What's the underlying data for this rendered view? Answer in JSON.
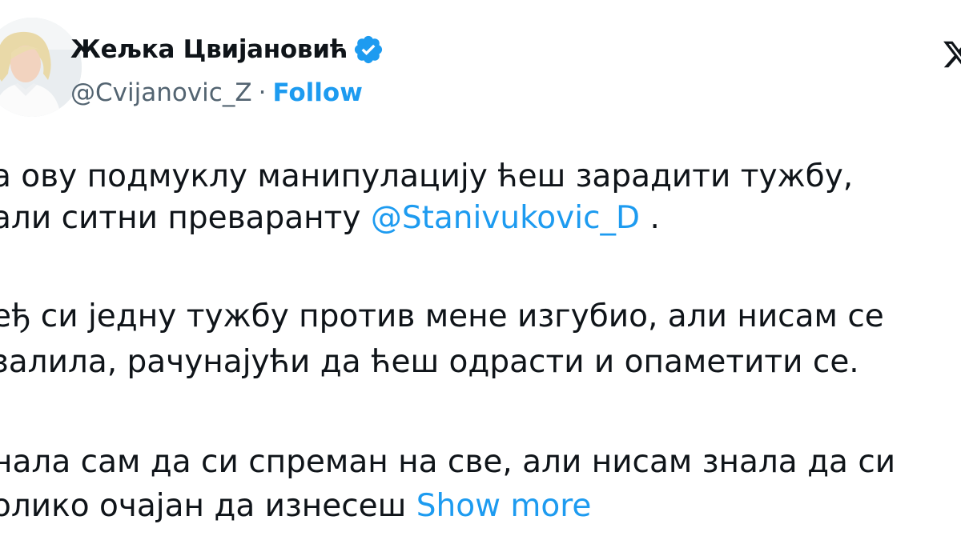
{
  "author": {
    "display_name": "Жељка Цвијановић",
    "handle": "@Cvijanovic_Z",
    "separator": "·",
    "follow_label": "Follow",
    "verified_icon": "verified-badge-icon",
    "avatar": "profile-photo"
  },
  "tweet": {
    "p1_l1": "а ову подмуклу манипулацију ћеш зарадити тужбу,",
    "p1_l2_a": "али ситни преваранту ",
    "mention": "@Stanivukovic_D",
    "p1_l2_b": " .",
    "p2_l1": "еђ си једну тужбу против мене изгубио, али нисам се",
    "p2_l2": "залила, рачунајући да ћеш одрасти и опаметити се.",
    "p3_l1": "нала сам да си спреман на све, али нисам знала да си",
    "p3_l2": "олико очајан да изнесеш ",
    "show_more_label": "Show more"
  },
  "colors": {
    "text": "#0f1419",
    "secondary": "#536471",
    "accent": "#1d9bf0"
  },
  "icons": {
    "close": "x-close-icon"
  }
}
